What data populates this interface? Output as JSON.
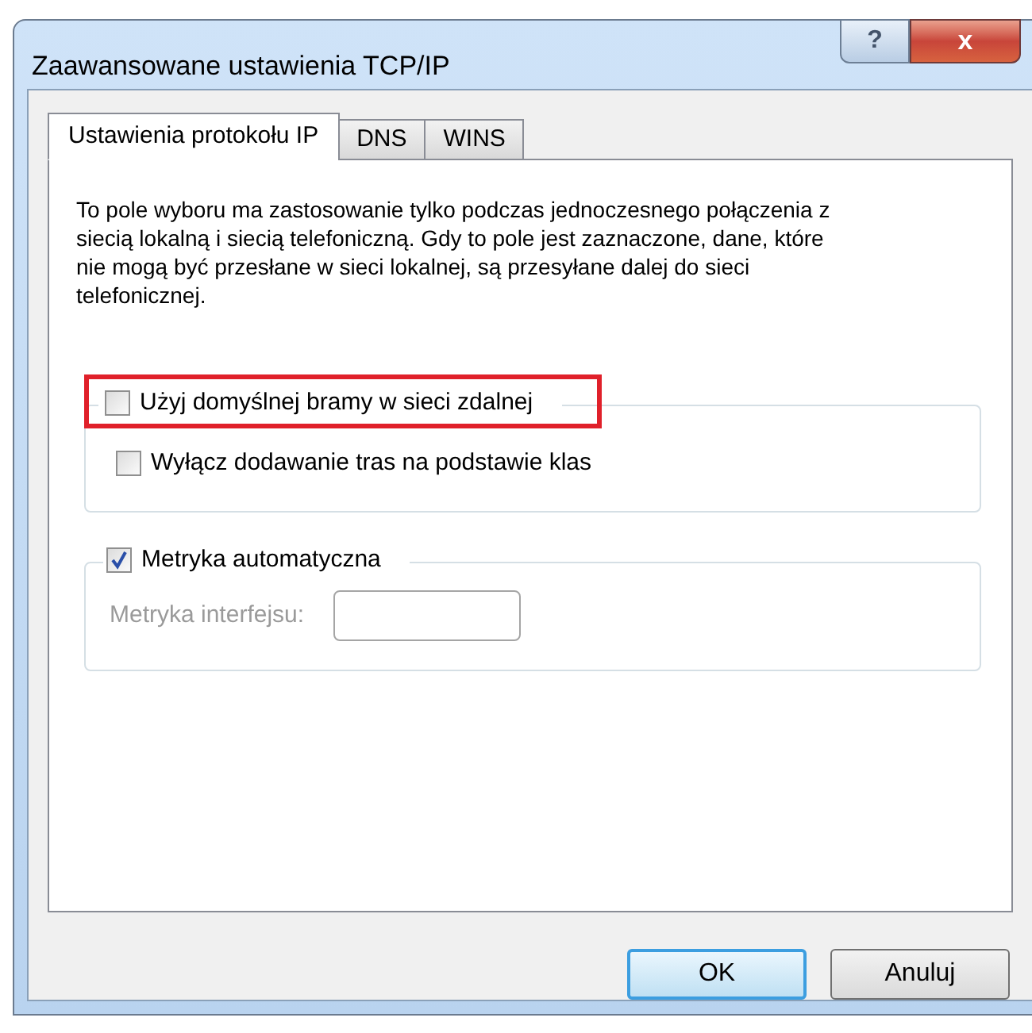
{
  "window": {
    "title": "Zaawansowane ustawienia TCP/IP",
    "controls": [
      "?",
      "x"
    ]
  },
  "tabs": [
    {
      "label": "Ustawienia protokołu IP",
      "selected": true
    },
    {
      "label": "DNS",
      "selected": false
    },
    {
      "label": "WINS",
      "selected": false
    }
  ],
  "description": "To pole wyboru ma zastosowanie tylko podczas jednoczesnego połączenia z siecią lokalną i siecią telefoniczną. Gdy to pole jest zaznaczone, dane, które nie mogą być przesłane w sieci lokalnej, są przesyłane dalej do sieci telefonicznej.",
  "gateway_group": {
    "checkbox": {
      "label": "Użyj domyślnej bramy w sieci zdalnej",
      "checked": false,
      "highlighted": true
    },
    "options": [
      {
        "label": "Wyłącz dodawanie tras na podstawie klas",
        "checked": false
      }
    ]
  },
  "metric_group": {
    "checkbox": {
      "label": "Metryka automatyczna",
      "checked": true
    },
    "field": {
      "label": "Metryka interfejsu:",
      "disabled": true
    }
  },
  "buttons": [
    {
      "label": "OK",
      "default": true
    },
    {
      "label": "Anuluj",
      "default": false
    }
  ]
}
